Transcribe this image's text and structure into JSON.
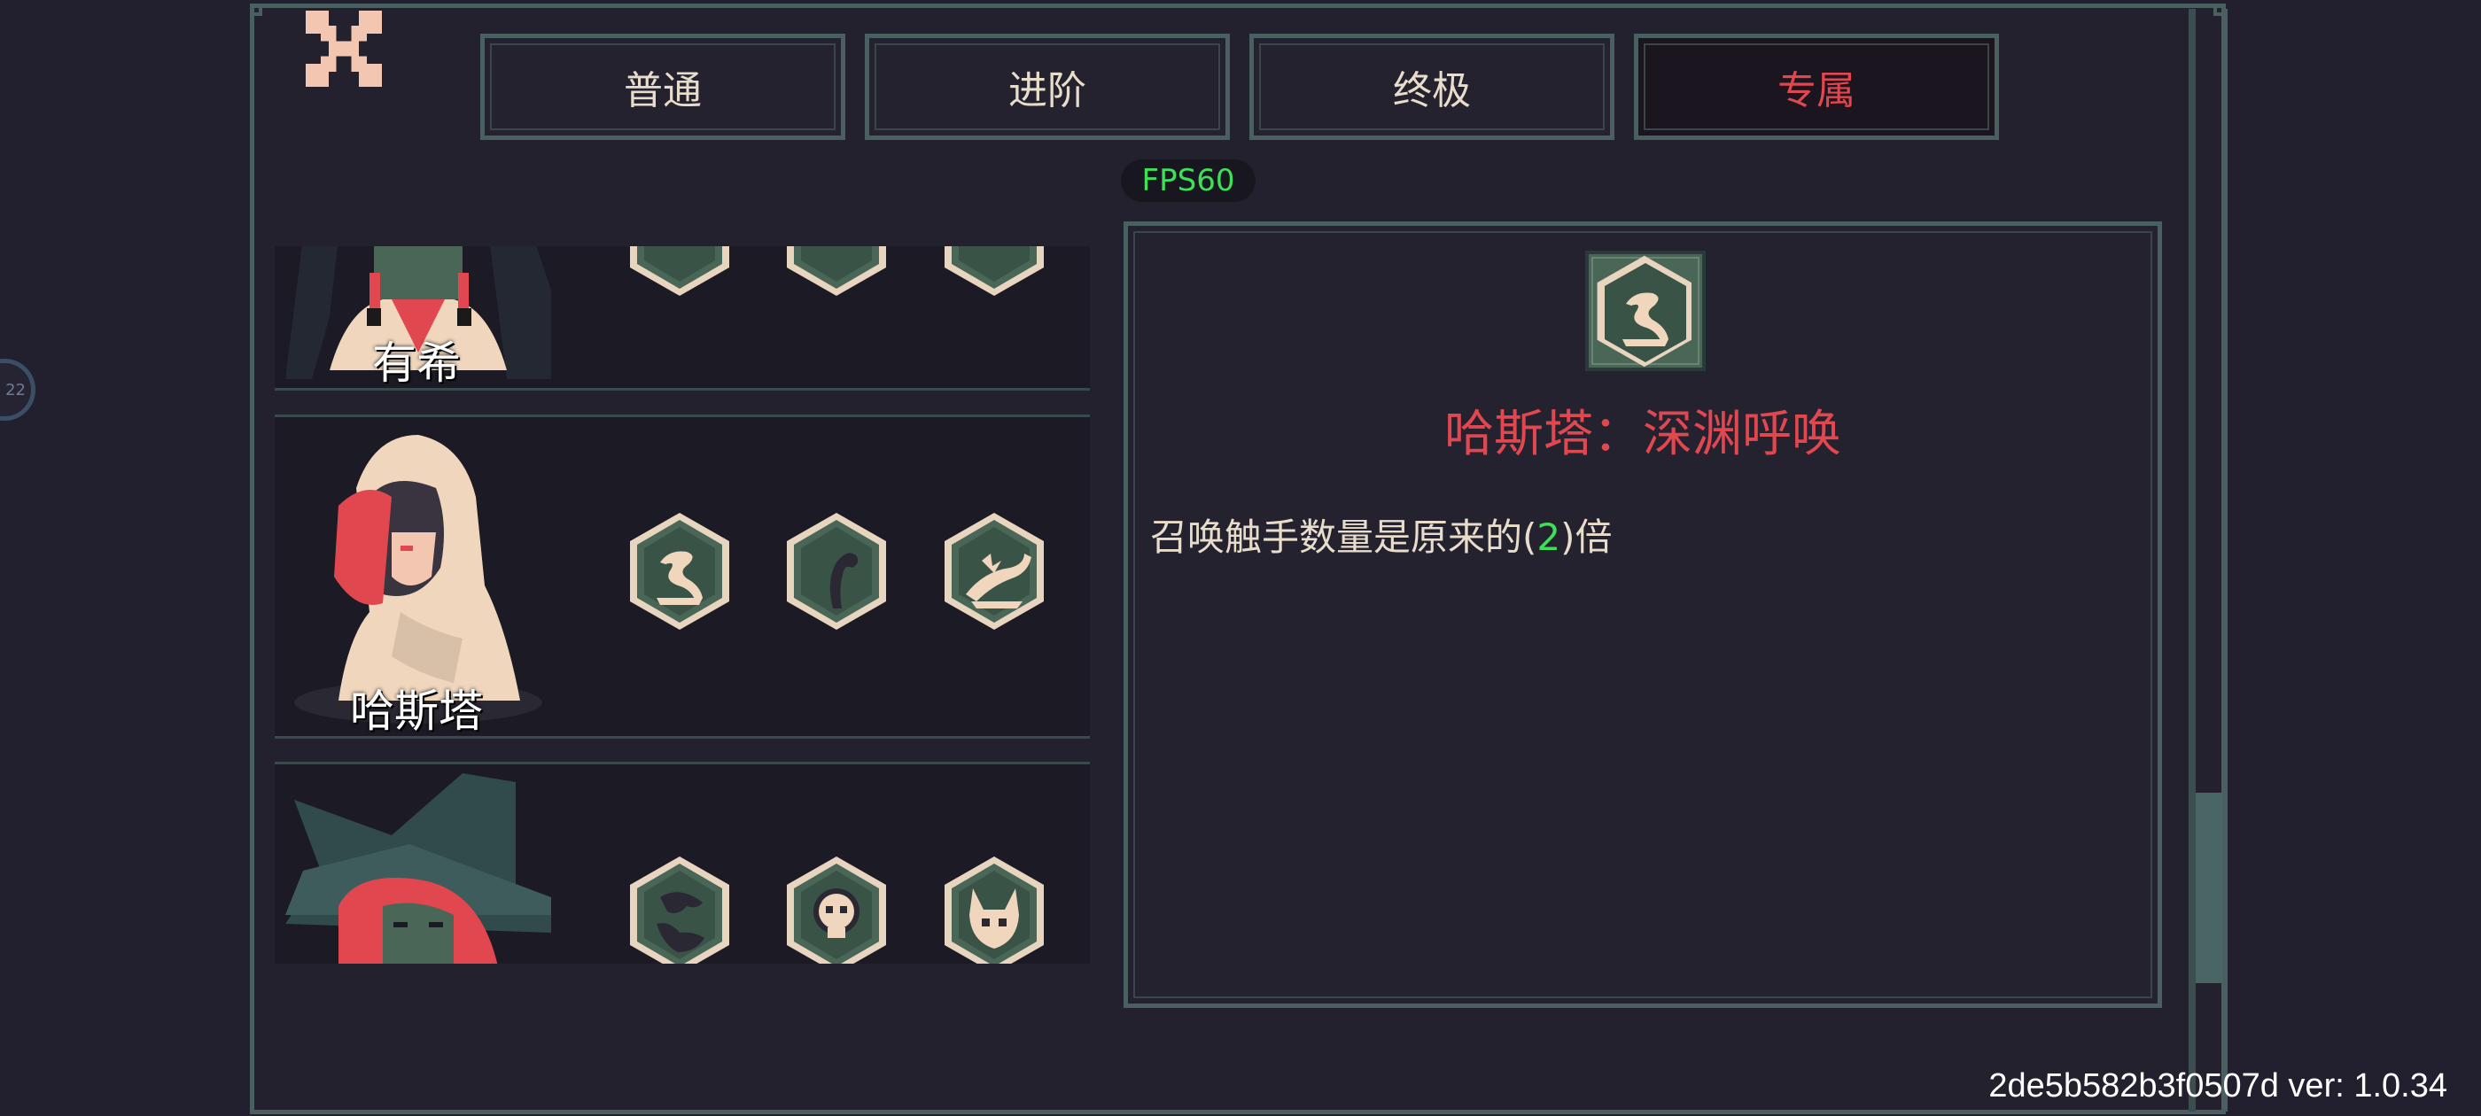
{
  "tabs": [
    {
      "label": "普通",
      "active": false
    },
    {
      "label": "进阶",
      "active": false
    },
    {
      "label": "终极",
      "active": false
    },
    {
      "label": "专属",
      "active": true
    }
  ],
  "fps_label": "FPS60",
  "side_bubble": "22",
  "characters": [
    {
      "name": "有希",
      "skills": [
        "hex-skill-icon",
        "hex-skill-icon",
        "hex-skill-icon"
      ]
    },
    {
      "name": "哈斯塔",
      "skills": [
        "tentacle-wave-icon",
        "tentacle-curl-icon",
        "tentacle-burst-icon"
      ]
    },
    {
      "name": "",
      "skills": [
        "globe-icon",
        "skull-icon",
        "horned-skull-icon"
      ]
    }
  ],
  "detail": {
    "icon": "tentacle-wave-icon",
    "title": "哈斯塔：深渊呼唤",
    "desc_before": "召唤触手数量是原来的(",
    "desc_value": "2",
    "desc_after": ")倍"
  },
  "version_text": "2de5b582b3f0507d ver: 1.0.34",
  "colors": {
    "accent_red": "#e0474f",
    "highlight_green": "#3ee05a",
    "frame": "#4a5f60",
    "background": "#22202e"
  }
}
